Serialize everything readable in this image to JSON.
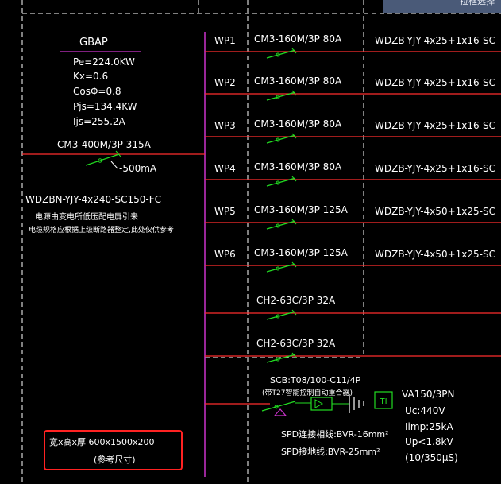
{
  "tooltip": "拉框选择",
  "panel": {
    "name": "GBAP",
    "params": [
      "Pe=224.0KW",
      "Kx=0.6",
      "CosΦ=0.8",
      "Pjs=134.4KW",
      "Ijs=255.2A"
    ],
    "main_breaker": "CM3-400M/3P 315A",
    "leakage": "-500mA",
    "incoming_cable": "WDZBN-YJY-4x240-SC150-FC",
    "note_1": "电源由变电所低压配电屏引来",
    "note_2": "电缆规格应根据上级断路器整定,此处仅供参考",
    "size_line1": "宽x高x厚 600x1500x200",
    "size_line2": "(参考尺寸)"
  },
  "circuits": [
    {
      "id": "WP1",
      "breaker": "CM3-160M/3P 80A",
      "cable": "WDZB-YJY-4x25+1x16-SC"
    },
    {
      "id": "WP2",
      "breaker": "CM3-160M/3P 80A",
      "cable": "WDZB-YJY-4x25+1x16-SC"
    },
    {
      "id": "WP3",
      "breaker": "CM3-160M/3P 80A",
      "cable": "WDZB-YJY-4x25+1x16-SC"
    },
    {
      "id": "WP4",
      "breaker": "CM3-160M/3P 80A",
      "cable": "WDZB-YJY-4x25+1x16-SC"
    },
    {
      "id": "WP5",
      "breaker": "CM3-160M/3P 125A",
      "cable": "WDZB-YJY-4x50+1x25-SC"
    },
    {
      "id": "WP6",
      "breaker": "CM3-160M/3P 125A",
      "cable": "WDZB-YJY-4x50+1x25-SC"
    },
    {
      "id": "",
      "breaker": "CH2-63C/3P 32A",
      "cable": ""
    },
    {
      "id": "",
      "breaker": "CH2-63C/3P 32A",
      "cable": ""
    }
  ],
  "spd": {
    "breaker": "SCB:T08/100-C11/4P",
    "breaker_note": "(带T27智能控制自动重合器)",
    "ti_label": "TI",
    "specs": [
      "VA150/3PN",
      "Uc:440V",
      "Iimp:25kA",
      "Up<1.8kV",
      "(10/350μS)"
    ],
    "wire_1": "SPD连接相线:BVR-16mm²",
    "wire_2": "SPD接地线:BVR-25mm²"
  },
  "colors": {
    "background": "#000000",
    "busbar": "#cc33cc",
    "feeder": "#ff2d2d",
    "breaker_symbol": "#22dd22",
    "text": "#ffffff",
    "highlight_box": "#ff2222"
  }
}
